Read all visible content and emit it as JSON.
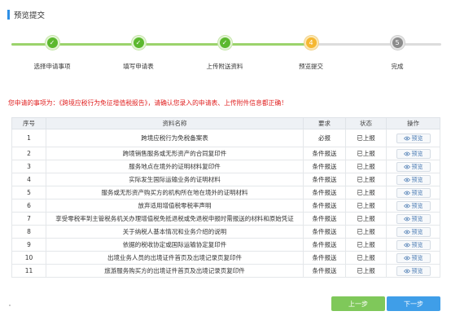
{
  "header": {
    "title": "预览提交"
  },
  "steps": [
    {
      "number": "✓",
      "label": "选择申请事项",
      "state": "done"
    },
    {
      "number": "✓",
      "label": "填写申请表",
      "state": "done"
    },
    {
      "number": "✓",
      "label": "上传附送资料",
      "state": "done"
    },
    {
      "number": "4",
      "label": "预览提交",
      "state": "current"
    },
    {
      "number": "5",
      "label": "完成",
      "state": "todo"
    }
  ],
  "notice": "您申请的事项为：《跨境应税行为免征增值税报告》，请确认您录入的申请表、上传附件信息都正确！",
  "table": {
    "headers": {
      "index": "序号",
      "name": "资料名称",
      "requirement": "要求",
      "status": "状态",
      "action": "操作"
    },
    "preview_label": "预览",
    "rows": [
      {
        "index": "1",
        "name": "跨境应税行为免税备案表",
        "requirement": "必报",
        "status": "已上报"
      },
      {
        "index": "2",
        "name": "跨境销售服务或无形资产的合同复印件",
        "requirement": "条件报送",
        "status": "已上报"
      },
      {
        "index": "3",
        "name": "服务地点在境外的证明材料复印件",
        "requirement": "条件报送",
        "status": "已上报"
      },
      {
        "index": "4",
        "name": "实际发生国际运输业务的证明材料",
        "requirement": "条件报送",
        "status": "已上报"
      },
      {
        "index": "5",
        "name": "服务或无形资产购买方的机构所在地在境外的证明材料",
        "requirement": "条件报送",
        "status": "已上报"
      },
      {
        "index": "6",
        "name": "放弃适用增值税零税率声明",
        "requirement": "条件报送",
        "status": "已上报"
      },
      {
        "index": "7",
        "name": "享受零税率到主管税务机关办理增值税免抵退税或免退税申报时需报送的材料和原始凭证",
        "requirement": "条件报送",
        "status": "已上报"
      },
      {
        "index": "8",
        "name": "关于纳税人基本情况和业务介绍的说明",
        "requirement": "条件报送",
        "status": "已上报"
      },
      {
        "index": "9",
        "name": "依据的税收协定或国际运输协定复印件",
        "requirement": "条件报送",
        "status": "已上报"
      },
      {
        "index": "10",
        "name": "出境业务人员的出境证件首页及出境记录页复印件",
        "requirement": "条件报送",
        "status": "已上报"
      },
      {
        "index": "11",
        "name": "旅游服务购买方的出境证件首页及出境记录页复印件",
        "requirement": "条件报送",
        "status": "已上报"
      }
    ]
  },
  "buttons": {
    "prev": "上一步",
    "next": "下一步"
  },
  "colors": {
    "accent": "#3f9ee8",
    "done": "#5cb82e",
    "current": "#f5b731",
    "notice": "#e02020"
  }
}
